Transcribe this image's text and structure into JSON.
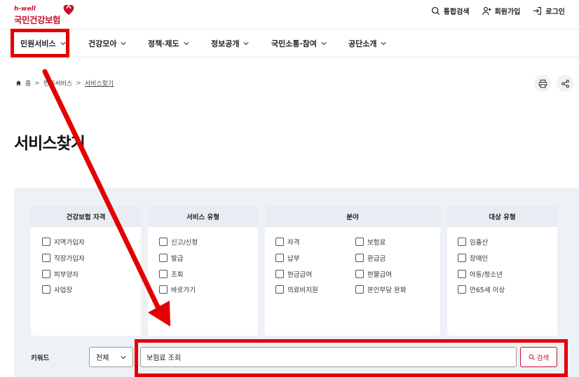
{
  "logo": {
    "tag": "h-well",
    "name": "국민건강보험"
  },
  "utility": [
    {
      "icon": "search-icon",
      "label": "통합검색"
    },
    {
      "icon": "user-plus-icon",
      "label": "회원가입"
    },
    {
      "icon": "login-icon",
      "label": "로그인"
    }
  ],
  "nav": [
    "민원서비스",
    "건강모아",
    "정책·제도",
    "정보공개",
    "국민소통·참여",
    "공단소개"
  ],
  "breadcrumb": {
    "home": "홈",
    "level1": "민원서비스",
    "current": "서비스찾기"
  },
  "page_title": "서비스찾기",
  "filters": {
    "eligibility": {
      "title": "건강보험 자격",
      "options": [
        "지역가입자",
        "직장가입자",
        "피부양자",
        "사업장"
      ]
    },
    "service_type": {
      "title": "서비스 유형",
      "options": [
        "신고/신청",
        "발급",
        "조회",
        "바로가기"
      ]
    },
    "field": {
      "title": "분야",
      "options": [
        "자격",
        "보험료",
        "납부",
        "환급금",
        "현금급여",
        "현물급여",
        "의료비지원",
        "본인부담 완화"
      ]
    },
    "target": {
      "title": "대상 유형",
      "options": [
        "임출산",
        "장애인",
        "아동/청소년",
        "만65세 이상"
      ]
    }
  },
  "keyword": {
    "label": "키워드",
    "scope": "전체",
    "value": "보험료 조회",
    "button": "검색"
  },
  "colors": {
    "brand": "#c8102e",
    "annotation": "#e30000",
    "panel_bg": "#eef1f6"
  }
}
